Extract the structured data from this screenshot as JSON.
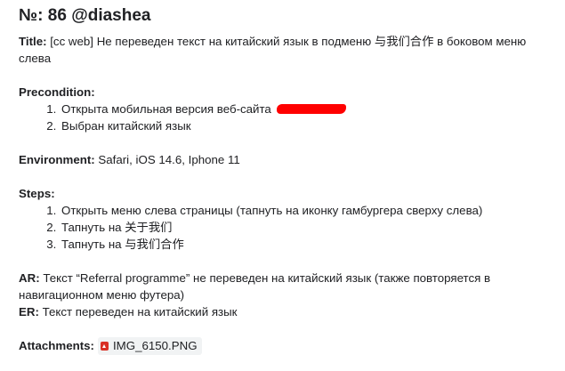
{
  "heading": "№: 86 @diashea",
  "title_field": {
    "label": "Title:",
    "value": " [cc web] Не переведен текст на китайский язык в подменю  与我们合作 в боковом меню слева"
  },
  "precondition": {
    "label": "Precondition:",
    "items": [
      "Открыта мобильная версия веб-сайта",
      "Выбран китайский язык"
    ]
  },
  "environment": {
    "label": "Environment:",
    "value": " Safari, iOS 14.6, Iphone 11"
  },
  "steps": {
    "label": "Steps:",
    "items": [
      "Открыть меню слева страницы (тапнуть на иконку гамбургера сверху слева)",
      "Тапнуть на 关于我们",
      "Тапнуть на 与我们合作"
    ]
  },
  "ar": {
    "label": "AR:",
    "value": " Текст “Referral programme” не переведен на китайский язык (также повторяется в навигационном меню футера)"
  },
  "er": {
    "label": "ER:",
    "value": " Текст переведен на китайский язык"
  },
  "attachments": {
    "label": "Attachments:",
    "file_name": "IMG_6150.PNG",
    "file_icon": "image-file-icon",
    "icon_color": "#d93025"
  }
}
